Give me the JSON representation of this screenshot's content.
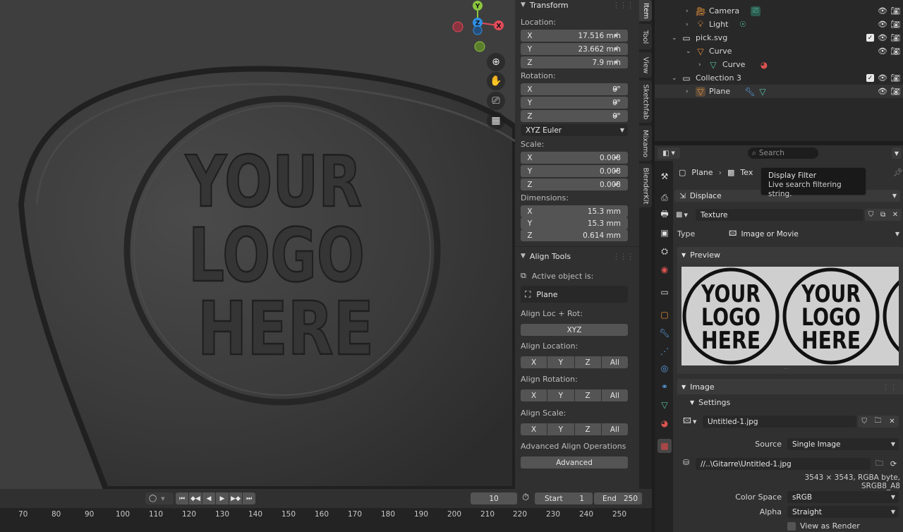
{
  "viewport": {
    "logo_lines": [
      "YOUR",
      "LOGO",
      "HERE"
    ],
    "gizmo": {
      "x": "X",
      "y": "Y",
      "z": "Z"
    },
    "colors": {
      "x_axis": "#e34b5a",
      "y_axis": "#8bc53f",
      "z_axis": "#2f8fe6",
      "origin": "#f0a020"
    }
  },
  "npanel": {
    "transform_title": "Transform",
    "location_label": "Location:",
    "location": [
      {
        "axis": "X",
        "value": "17.516 mm"
      },
      {
        "axis": "Y",
        "value": "23.662 mm"
      },
      {
        "axis": "Z",
        "value": "7.9 mm"
      }
    ],
    "rotation_label": "Rotation:",
    "rotation": [
      {
        "axis": "X",
        "value": "0°"
      },
      {
        "axis": "Y",
        "value": "0°"
      },
      {
        "axis": "Z",
        "value": "0°"
      }
    ],
    "rotation_mode": "XYZ Euler",
    "scale_label": "Scale:",
    "scale": [
      {
        "axis": "X",
        "value": "0.008"
      },
      {
        "axis": "Y",
        "value": "0.008"
      },
      {
        "axis": "Z",
        "value": "0.008"
      }
    ],
    "dimensions_label": "Dimensions:",
    "dimensions": [
      {
        "axis": "X",
        "value": "15.3 mm"
      },
      {
        "axis": "Y",
        "value": "15.3 mm"
      },
      {
        "axis": "Z",
        "value": "0.614 mm"
      }
    ],
    "align_title": "Align Tools",
    "active_object_label": "Active object is:",
    "active_object": "Plane",
    "align_loc_rot_label": "Align Loc + Rot:",
    "align_loc_rot_btn": "XYZ",
    "align_location_label": "Align Location:",
    "align_rotation_label": "Align Rotation:",
    "align_scale_label": "Align Scale:",
    "axis_buttons": [
      "X",
      "Y",
      "Z",
      "All"
    ],
    "advanced_label": "Advanced Align Operations",
    "advanced_btn": "Advanced"
  },
  "vtabs": [
    "Item",
    "Tool",
    "View",
    "Sketchfab",
    "Mixamo",
    "BlenderKit"
  ],
  "timeline": {
    "current_frame": "10",
    "start_label": "Start",
    "start_value": "1",
    "end_label": "End",
    "end_value": "250",
    "ticks": [
      "70",
      "80",
      "90",
      "100",
      "110",
      "120",
      "130",
      "140",
      "150",
      "160",
      "170",
      "180",
      "190",
      "200",
      "210",
      "220",
      "230",
      "240",
      "250"
    ]
  },
  "outliner": {
    "rows": [
      {
        "name": "Camera",
        "icon": "camera-icon"
      },
      {
        "name": "Light",
        "icon": "light-icon"
      },
      {
        "name": "pick.svg",
        "icon": "collection-icon"
      },
      {
        "name": "Curve",
        "icon": "curve-icon"
      },
      {
        "name": "Curve",
        "icon": "curve-data-icon"
      },
      {
        "name": "Collection 3",
        "icon": "collection-icon"
      },
      {
        "name": "Plane",
        "icon": "mesh-icon"
      }
    ]
  },
  "properties": {
    "search_placeholder": "Search",
    "breadcrumb_object": "Plane",
    "breadcrumb_texture": "Tex",
    "tooltip_title": "Display Filter",
    "tooltip_text": "Live search filtering string.",
    "modifier": "Displace",
    "texture_name": "Texture",
    "type_label": "Type",
    "type_value": "Image or Movie",
    "preview_title": "Preview",
    "image_title": "Image",
    "settings_title": "Settings",
    "image_name": "Untitled-1.jpg",
    "source_label": "Source",
    "source_value": "Single Image",
    "filepath": "//..\\Gitarre\\Untitled-1.jpg",
    "image_info": "3543 × 3543,  RGBA byte,  SRGB8_A8",
    "color_space_label": "Color Space",
    "color_space_value": "sRGB",
    "alpha_label": "Alpha",
    "alpha_value": "Straight",
    "view_as_render": "View as Render"
  }
}
